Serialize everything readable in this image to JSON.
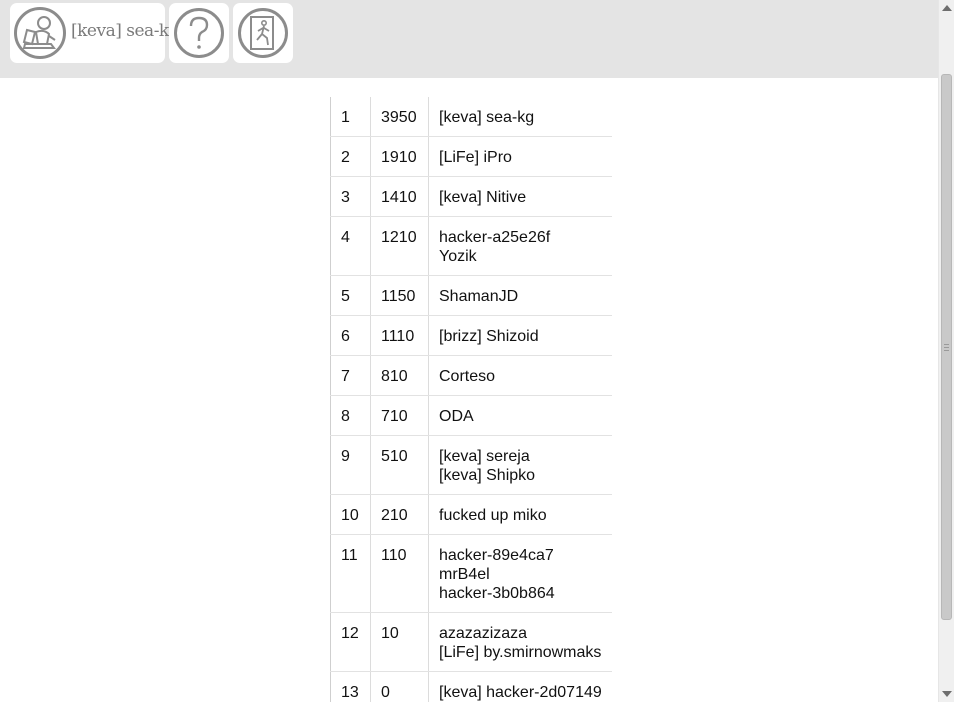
{
  "header": {
    "user_name": "[keva] sea-kg",
    "icons": {
      "avatar": "user-at-computer-icon",
      "help": "question-mark-icon",
      "exit": "exit-door-icon"
    }
  },
  "scoreboard": {
    "rows": [
      {
        "rank": "1",
        "points": "3950",
        "names": [
          "[keva] sea-kg"
        ]
      },
      {
        "rank": "2",
        "points": "1910",
        "names": [
          "[LiFe] iPro"
        ]
      },
      {
        "rank": "3",
        "points": "1410",
        "names": [
          "[keva] Nitive"
        ]
      },
      {
        "rank": "4",
        "points": "1210",
        "names": [
          "hacker-a25e26f",
          "Yozik"
        ]
      },
      {
        "rank": "5",
        "points": "1150",
        "names": [
          "ShamanJD"
        ]
      },
      {
        "rank": "6",
        "points": "1110",
        "names": [
          "[brizz] Shizoid"
        ]
      },
      {
        "rank": "7",
        "points": "810",
        "names": [
          "Corteso"
        ]
      },
      {
        "rank": "8",
        "points": "710",
        "names": [
          "ODA"
        ]
      },
      {
        "rank": "9",
        "points": "510",
        "names": [
          "[keva] sereja",
          "[keva] Shipko"
        ]
      },
      {
        "rank": "10",
        "points": "210",
        "names": [
          "fucked up miko"
        ]
      },
      {
        "rank": "11",
        "points": "110",
        "names": [
          "hacker-89e4ca7",
          "mrB4el",
          "hacker-3b0b864"
        ]
      },
      {
        "rank": "12",
        "points": "10",
        "names": [
          "azazazizaza",
          "[LiFe] by.smirnowmaks"
        ]
      },
      {
        "rank": "13",
        "points": "0",
        "names": [
          "[keva] hacker-2d07149"
        ]
      }
    ]
  },
  "colors": {
    "topbar": "#e4e4e4",
    "icon_stroke": "#8c8c8c",
    "row_border": "#e2e2e2"
  }
}
